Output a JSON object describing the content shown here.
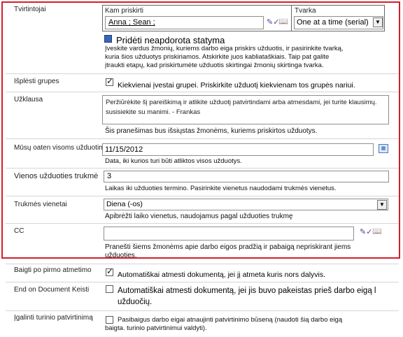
{
  "approvers": {
    "label": "Tvirtintojai",
    "assign_to_header": "Kam priskirti",
    "order_header": "Tvarka",
    "people_value": "Anna ; Sean ;",
    "order_value": "One at a time (serial)",
    "add_stage_label": "Pridėti neapdorota statyma",
    "help": "Įveskite vardus žmonių, kuriems darbo eiga priskirs užduotis, ir pasirinkite tvarką, kuria šios užduotys priskiriamos. Atskirkite juos kabliataškiais. Taip pat galite įtraukti etapų, kad priskirtumėte užduotis skirtingai žmonių skirtinga tvarka."
  },
  "expand_groups": {
    "label": "Išplėsti grupes",
    "checkbox_text": "Kiekvienai įvestai grupei. Priskirkite užduotį kiekvienam tos grupės nariui."
  },
  "request": {
    "label": "Užklausa",
    "value": "Peržiūrėkite šį pareiškimą ir atlikite užduotį patvirtindami arba atmesdami, jei turite klausimų. susisiekite su manimi. - Frankas",
    "help": "Šis pranešimas bus išsiųstas žmonėms, kuriems priskirtos užduotys."
  },
  "due_date": {
    "label": "Mūsų oaten visoms užduotims",
    "value": "11/15/2012",
    "help": "Data, iki kurios turi būti atliktos visos užduotys."
  },
  "duration": {
    "label": "Vienos užduoties trukmė",
    "value": "3",
    "help": "Laikas iki užduoties termino. Pasirinkite vienetus naudodami trukmės vienetus."
  },
  "duration_units": {
    "label": "Trukmės vienetai",
    "value": "Diena (-os)",
    "help": "Apibrėžti laiko vienetus, naudojamus pagal užduoties trukmę"
  },
  "cc": {
    "label": "CC",
    "value": "",
    "help": "Pranešti šiems žmonėms apie darbo eigos pradžią ir pabaigą nepriskirant jiems užduoties."
  },
  "end_first_reject": {
    "label": "Baigti po pirmo atmetimo",
    "checkbox_text": "Automatiškai atmesti dokumentą, jei jį atmeta kuris nors dalyvis."
  },
  "end_on_change": {
    "label": "End on Document Keisti",
    "checkbox_text": "Automatiškai atmesti dokumentą, jei jis buvo pakeistas prieš darbo eigą l užduočių."
  },
  "enable_content_approval": {
    "label": "Įgalinti turinio patvirtinimą",
    "checkbox_text": "Pasibaigus darbo eigai atnaujinti patvirtinimo būseną (naudoti šią darbo eigą baigta. turinio patvirtinimui valdyti)."
  },
  "icons": {
    "check_names": "check-names-icon",
    "address_book": "address-book-icon",
    "calendar": "calendar-icon",
    "add_stage": "add-stage-icon"
  },
  "colors": {
    "highlight_border": "#d0202c"
  }
}
